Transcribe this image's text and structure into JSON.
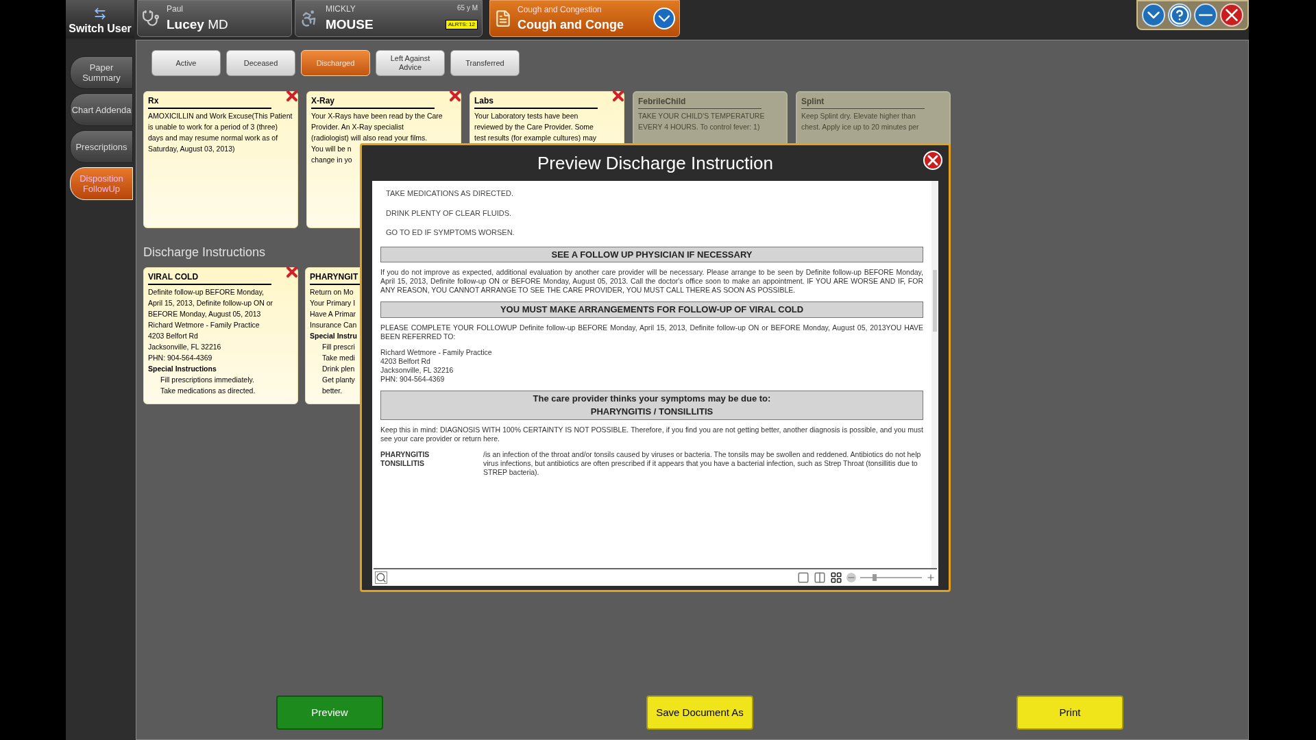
{
  "header": {
    "switch_user": "Switch User",
    "provider": {
      "first_name": "Paul",
      "name": "**Lucey** MD"
    },
    "patient": {
      "first_name": "MICKLY",
      "age_sex": "65 y M",
      "last_name": "MOUSE",
      "alert_badge": "ALRTS: 12"
    },
    "complaint": {
      "subtitle": "Cough and Congestion",
      "title": "Cough and Conge"
    }
  },
  "side_tabs": [
    {
      "label": "Paper Summary",
      "selected": false
    },
    {
      "label": "Chart Addenda",
      "selected": false
    },
    {
      "label": "Prescriptions",
      "selected": false
    },
    {
      "label": "Disposition FollowUp",
      "selected": true
    }
  ],
  "status_tabs": [
    {
      "label": "Active",
      "selected": false
    },
    {
      "label": "Deceased",
      "selected": false
    },
    {
      "label": "Discharged",
      "selected": true
    },
    {
      "label": "Left Against Advice",
      "selected": false
    },
    {
      "label": "Transferred",
      "selected": false
    }
  ],
  "order_cards": [
    {
      "title": "Rx",
      "disabled": false,
      "lines": [
        {
          "kind": "paragraph",
          "text": "AMOXICILLIN and Work Excuse(This Patient is unable to work for a period of 3 (three) days and may resume normal work as of Saturday, August 03, 2013)"
        }
      ]
    },
    {
      "title": "X-Ray",
      "disabled": false,
      "lines": [
        {
          "kind": "text",
          "text": "Your X-Rays have been read by the Care"
        },
        {
          "kind": "text",
          "text": "Provider. An X-Ray specialist"
        },
        {
          "kind": "text",
          "text": "(radiologist) will also read your films."
        },
        {
          "kind": "text",
          "text": "You will be n"
        },
        {
          "kind": "text",
          "text": "change in yo"
        }
      ]
    },
    {
      "title": "Labs",
      "disabled": false,
      "lines": [
        {
          "kind": "text",
          "text": "Your Laboratory tests have been"
        },
        {
          "kind": "text",
          "text": "reviewed by the Care Provider. Some"
        },
        {
          "kind": "text",
          "text": "test results (for example cultures) may"
        }
      ]
    },
    {
      "title": "FebrileChild",
      "disabled": true,
      "lines": [
        {
          "kind": "text",
          "text": "TAKE YOUR CHILD'S TEMPERATURE"
        },
        {
          "kind": "text",
          "text": "EVERY 4 HOURS. To control fever: 1)"
        }
      ]
    },
    {
      "title": "Splint",
      "disabled": true,
      "lines": [
        {
          "kind": "text",
          "text": "Keep Splint dry. Elevate higher than"
        },
        {
          "kind": "text",
          "text": "chest. Apply ice up to 20 minutes per"
        }
      ]
    }
  ],
  "discharge_section": {
    "heading": "Discharge Instructions",
    "cards": [
      {
        "title": "VIRAL COLD",
        "disabled": false,
        "lines": [
          {
            "kind": "text",
            "text": "Definite follow-up BEFORE Monday,"
          },
          {
            "kind": "text",
            "text": "April 15, 2013, Definite follow-up ON or"
          },
          {
            "kind": "text",
            "text": "BEFORE Monday, August 05, 2013"
          },
          {
            "kind": "text",
            "text": "Richard  Wetmore - Family Practice"
          },
          {
            "kind": "text",
            "text": "4203 Belfort Rd"
          },
          {
            "kind": "text",
            "text": "Jacksonville, FL 32216"
          },
          {
            "kind": "text",
            "text": "PHN: 904-564-4369"
          },
          {
            "kind": "heading",
            "text": "Special Instructions"
          },
          {
            "kind": "item",
            "text": "Fill prescriptions immediately."
          },
          {
            "kind": "item",
            "text": "Take medications as directed."
          }
        ]
      },
      {
        "title": "PHARYNGIT",
        "disabled": false,
        "lines": [
          {
            "kind": "text",
            "text": "Return on Mo"
          },
          {
            "kind": "text",
            "text": "Your Primary I"
          },
          {
            "kind": "text",
            "text": "Have A Primar"
          },
          {
            "kind": "text",
            "text": "Insurance Can"
          },
          {
            "kind": "heading",
            "text": "Special Instru"
          },
          {
            "kind": "item",
            "text": "Fill prescri"
          },
          {
            "kind": "item",
            "text": "Take medi"
          },
          {
            "kind": "item",
            "text": "Drink plen"
          },
          {
            "kind": "item",
            "text": "Get planty"
          },
          {
            "kind": "item",
            "text": "better."
          }
        ]
      }
    ]
  },
  "preview_dialog": {
    "title": "Preview Discharge Instruction",
    "document": [
      {
        "kind": "line",
        "text": "TAKE MEDICATIONS AS DIRECTED."
      },
      {
        "kind": "line",
        "text": "DRINK PLENTY OF CLEAR FLUIDS."
      },
      {
        "kind": "line",
        "text": "GO TO ED IF SYMPTOMS WORSEN."
      },
      {
        "kind": "banner",
        "text": "SEE A FOLLOW UP PHYSICIAN IF NECESSARY"
      },
      {
        "kind": "paragraph",
        "text": "If you do not improve as expected, additional evaluation by another care provider will be necessary. Please arrange to be seen by Definite follow-up BEFORE Monday, April 15, 2013, Definite follow-up ON or BEFORE Monday, August 05, 2013. Call the doctor's office soon to make an appointment. IF YOU ARE WORSE AND IF, FOR ANY REASON, YOU CANNOT ARRANGE TO SEE THE CARE PROVIDER, YOU MUST CALL THERE AS SOON AS POSSIBLE."
      },
      {
        "kind": "banner",
        "text": "YOU MUST MAKE ARRANGEMENTS FOR FOLLOW-UP OF VIRAL COLD"
      },
      {
        "kind": "paragraph",
        "text": "PLEASE COMPLETE YOUR FOLLOWUP Definite follow-up BEFORE Monday, April 15, 2013, Definite follow-up ON or BEFORE Monday, August 05, 2013YOU HAVE BEEN REFERRED TO:"
      },
      {
        "kind": "address",
        "lines": [
          "Richard  Wetmore - Family Practice",
          "4203 Belfort Rd",
          "Jacksonville, FL 32216",
          "PHN: 904-564-4369"
        ]
      },
      {
        "kind": "banner",
        "text": "The care provider thinks your symptoms may be due to:",
        "subtext": "PHARYNGITIS / TONSILLITIS"
      },
      {
        "kind": "paragraph",
        "text": "Keep this in mind: DIAGNOSIS WITH 100% CERTAINTY IS NOT POSSIBLE. Therefore, if you find you are not getting better, another diagnosis is possible, and you must see your care provider or return here."
      },
      {
        "kind": "definition",
        "terms": [
          "PHARYNGITIS",
          "TONSILLITIS"
        ],
        "text": "/is an infection of the throat and/or tonsils caused by viruses or bacteria. The tonsils may be swollen and reddened. Antibiotics do not help virus infections, but antibiotics are often prescribed if it appears that you have a bacterial infection, such as Strep Throat (tonsillitis due to STREP bacteria)."
      }
    ],
    "zoom": {
      "level": 0.2
    }
  },
  "footer_buttons": [
    {
      "label": "Preview",
      "kind": "green"
    },
    {
      "label": "Save Document As",
      "kind": "yellow"
    },
    {
      "label": "Print",
      "kind": "yellow"
    }
  ]
}
